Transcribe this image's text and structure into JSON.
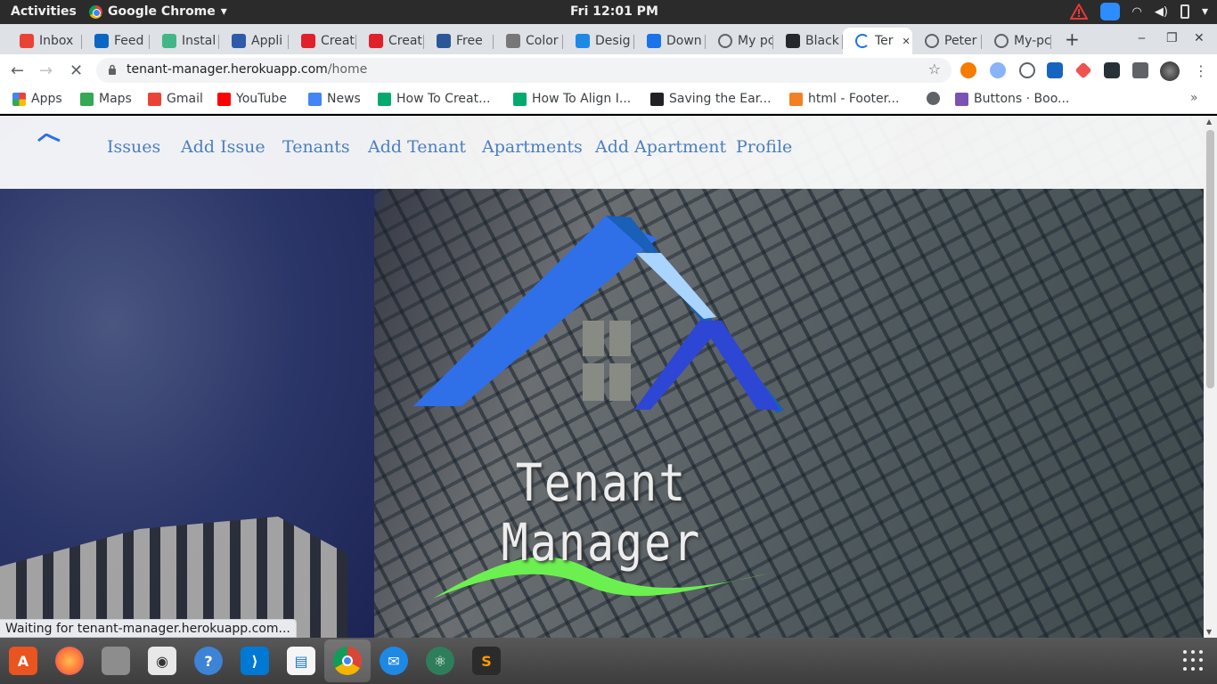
{
  "system": {
    "activities": "Activities",
    "app_name": "Google Chrome",
    "clock": "Fri 12:01 PM"
  },
  "tabs": [
    {
      "label": "Inbox",
      "icon": "gmail-icon",
      "color": "#ea4335"
    },
    {
      "label": "Feed",
      "icon": "linkedin-icon",
      "color": "#0a66c2"
    },
    {
      "label": "Instal",
      "icon": "vue-icon",
      "color": "#41b883"
    },
    {
      "label": "Appli",
      "icon": "webapp-icon",
      "color": "#2f5aa8"
    },
    {
      "label": "Creat",
      "icon": "s-red-icon",
      "color": "#e0202a"
    },
    {
      "label": "Creat",
      "icon": "s-red-icon",
      "color": "#e0202a"
    },
    {
      "label": "Free",
      "icon": "tm-icon",
      "color": "#2b5797"
    },
    {
      "label": "Color",
      "icon": "wordpress-icon",
      "color": "#777777"
    },
    {
      "label": "Desig",
      "icon": "t-blue-icon",
      "color": "#1e88e5"
    },
    {
      "label": "Down",
      "icon": "download-icon",
      "color": "#1a73e8"
    },
    {
      "label": "My pc",
      "icon": "globe-icon",
      "color": "#5f6368"
    },
    {
      "label": "Black",
      "icon": "github-icon",
      "color": "#24292e"
    },
    {
      "label": "Ter",
      "icon": "loading-icon",
      "color": "#1a73e8"
    },
    {
      "label": "Peter",
      "icon": "globe-icon",
      "color": "#5f6368"
    },
    {
      "label": "My-pc",
      "icon": "globe-icon",
      "color": "#5f6368"
    }
  ],
  "address": {
    "host": "tenant-manager.herokuapp.com",
    "path": "/home"
  },
  "bookmarks": [
    {
      "label": "Apps",
      "icon": "apps-grid-icon",
      "color": "#4285f4"
    },
    {
      "label": "Maps",
      "icon": "maps-pin-icon",
      "color": "#34a853"
    },
    {
      "label": "Gmail",
      "icon": "gmail-icon",
      "color": "#ea4335"
    },
    {
      "label": "YouTube",
      "icon": "youtube-icon",
      "color": "#ff0000"
    },
    {
      "label": "News",
      "icon": "news-icon",
      "color": "#4285f4"
    },
    {
      "label": "How To Creat...",
      "icon": "w3schools-icon",
      "color": "#04aa6d"
    },
    {
      "label": "How To Align I...",
      "icon": "w3schools-icon",
      "color": "#04aa6d"
    },
    {
      "label": "Saving the Ear...",
      "icon": "g-icon",
      "color": "#202124"
    },
    {
      "label": "html - Footer...",
      "icon": "stackoverflow-icon",
      "color": "#f48024"
    },
    {
      "label": "",
      "icon": "globe-icon",
      "color": "#5f6368"
    },
    {
      "label": "Buttons · Boo...",
      "icon": "bootstrap-icon",
      "color": "#7952b3"
    }
  ],
  "site": {
    "nav": [
      "Issues",
      "Add Issue",
      "Tenants",
      "Add Tenant",
      "Apartments",
      "Add Apartment",
      "Profile"
    ],
    "hero_title": "Tenant Manager",
    "colors": {
      "link": "#4a7fc1",
      "roof": "#2f6fe8",
      "wave": "#6cf050"
    }
  },
  "status": "Waiting for tenant-manager.herokuapp.com..."
}
